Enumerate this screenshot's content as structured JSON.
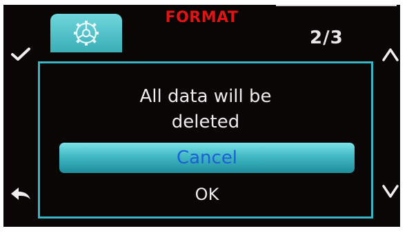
{
  "header": {
    "title": "FORMAT",
    "page_indicator": "2/3",
    "tab_icon": "gear-icon"
  },
  "dialog": {
    "message_line1": "All data will be",
    "message_line2": "deleted",
    "cancel_label": "Cancel",
    "ok_label": "OK"
  },
  "side_controls": {
    "left_top": "checkmark-icon",
    "left_bottom": "back-arrow-icon",
    "right_top": "chevron-up-icon",
    "right_bottom": "chevron-down-icon"
  },
  "colors": {
    "background": "#0a0606",
    "accent": "#38b6c4",
    "title": "#e01414",
    "selected_text": "#1c5fd6"
  }
}
